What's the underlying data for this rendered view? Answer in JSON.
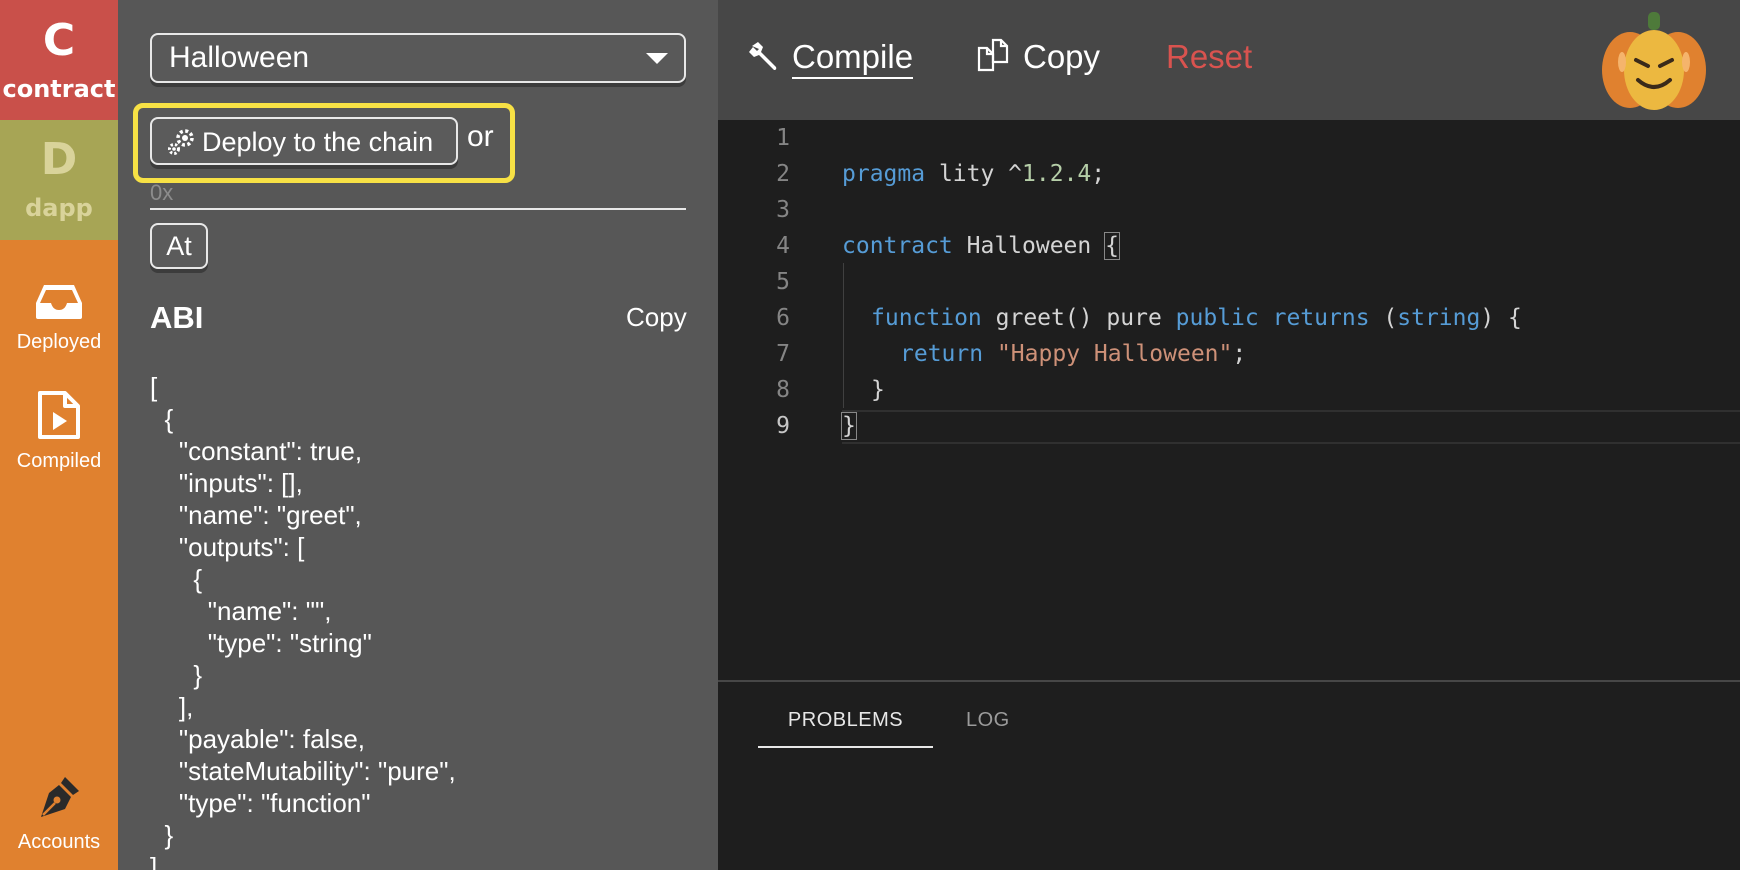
{
  "rail": {
    "contract": {
      "letter": "C",
      "word": "contract"
    },
    "dapp": {
      "letter": "D",
      "word": "dapp"
    },
    "deployed_label": "Deployed",
    "compiled_label": "Compiled",
    "accounts_label": "Accounts"
  },
  "panel": {
    "contract_select": "Halloween",
    "deploy_button": "Deploy to the chain",
    "or_text": "or",
    "address_placeholder": "0x",
    "at_button": "At",
    "abi_title": "ABI",
    "abi_copy": "Copy",
    "abi_json": "[\n  {\n    \"constant\": true,\n    \"inputs\": [],\n    \"name\": \"greet\",\n    \"outputs\": [\n      {\n        \"name\": \"\",\n        \"type\": \"string\"\n      }\n    ],\n    \"payable\": false,\n    \"stateMutability\": \"pure\",\n    \"type\": \"function\"\n  }\n]"
  },
  "toolbar": {
    "compile": "Compile",
    "copy": "Copy",
    "reset": "Reset"
  },
  "editor": {
    "line_numbers": [
      "1",
      "2",
      "3",
      "4",
      "5",
      "6",
      "7",
      "8",
      "9"
    ],
    "tokens": {
      "pragma": "pragma",
      "lity": " lity ^",
      "version": "1.2.4",
      "semicolon": ";",
      "contract": "contract",
      "contract_name": " Halloween ",
      "open_brace": "{",
      "function": "function",
      "greet": " greet() pure ",
      "public": "public",
      "returns": "returns",
      "paren_open": " (",
      "string": "string",
      "paren_close": ") {",
      "return": "return",
      "greeting": "\"Happy Halloween\"",
      "return_semicolon": ";",
      "inner_close": "}",
      "close_brace": "}"
    }
  },
  "bottom_panel": {
    "tabs": [
      "PROBLEMS",
      "LOG"
    ]
  },
  "colors": {
    "contract_tile": "#c9504a",
    "dapp_tile": "#a7a555",
    "rail": "#e0812f",
    "highlight": "#f7e145",
    "reset": "#d9534f",
    "keyword": "#569cd6",
    "string": "#ce9178"
  },
  "icons": [
    "gears-icon",
    "wrench-icon",
    "copy-icon",
    "pumpkin-logo",
    "inbox-icon",
    "play-file-icon",
    "pen-nib-icon",
    "chevron-down-icon"
  ]
}
